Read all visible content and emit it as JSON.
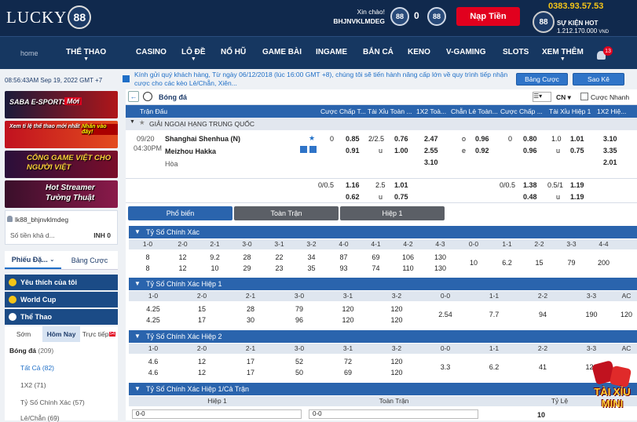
{
  "brand": {
    "name": "LUCKY",
    "badge": "88"
  },
  "header": {
    "greeting": "Xin chào!",
    "username": "BHJNVKLMDEG",
    "coin_label": "88",
    "balance": "0",
    "deposit_label": "Nạp Tiền"
  },
  "jackpot": {
    "phone": "0383.93.57.53",
    "event": "SỰ KIỆN HOT",
    "amount": "1.212.170.000",
    "currency": "VND"
  },
  "nav": {
    "home": "home",
    "items": [
      "THỂ THAO",
      "CASINO",
      "LÔ ĐỀ",
      "NỔ HŨ",
      "GAME BÀI",
      "INGAME",
      "BẮN CÁ",
      "KENO",
      "V-GAMING",
      "SLOTS",
      "XEM THÊM"
    ],
    "notify_count": "13"
  },
  "sidebar": {
    "time": "08:56:43AM Sep 19, 2022 GMT +7",
    "banners": [
      "SABA E-SPORTS",
      "Mới",
      "Xem tỉ lệ thể thao mới nhất",
      "Nhấn vào đây!",
      "CỔNG GAME VIỆT CHO NGƯỜI VIỆT",
      "Hot Streamer Tường Thuật"
    ],
    "user": "lk88_bhjnvklmdeg",
    "balance_label": "Số tiền khả d...",
    "balance_value": "INH 0",
    "tabs": [
      "Phiếu Đặ...",
      "Bảng Cược"
    ],
    "sections": [
      "Yêu thích của tôi",
      "World Cup",
      "Thể Thao"
    ],
    "subtabs": [
      "Sớm",
      "Hôm Nay",
      "Trực tiếp"
    ],
    "live_count": "54",
    "sports": [
      {
        "name": "Bóng đá",
        "count": "(209)"
      },
      {
        "name": "Tất Cả",
        "count": "(82)"
      },
      {
        "name": "1X2",
        "count": "(71)"
      },
      {
        "name": "Tỷ Số Chính Xác",
        "count": "(57)"
      },
      {
        "name": "Lẻ/Chẵn",
        "count": "(69)"
      }
    ]
  },
  "main": {
    "ticker": "Kính gửi quý khách hàng, Từ ngày 06/12/2018 (lúc 16:00 GMT +8), chúng tôi sẽ tiến hành nâng cấp lớn về quy trình tiếp nhận cược cho các kèo Lẻ/Chẵn, Xiên...",
    "btn_board": "Bảng Cược",
    "btn_statement": "Sao Kê",
    "sport": "Bóng đá",
    "lang": "CN",
    "bet_mode": "Cược Nhanh",
    "headers": [
      "Trận Đấu",
      "Cược Chấp T...",
      "Tài Xỉu Toàn ...",
      "1X2 Toà...",
      "Chẵn Lẻ Toàn...",
      "Cược Chấp ...",
      "Tài Xỉu Hiệp 1",
      "1X2 Hiệ..."
    ],
    "league": "GIẢI NGOẠI HẠNG TRUNG QUỐC",
    "match": {
      "date": "09/20",
      "time": "04:30PM",
      "home": "Shanghai Shenhua (N)",
      "away": "Meizhou Hakka",
      "draw": "Hòa",
      "r1": [
        "0",
        "0.85",
        "2/2.5",
        "0.76",
        "2.47",
        "o",
        "0.96",
        "0",
        "0.80",
        "1.0",
        "1.01",
        "3.10"
      ],
      "r2": [
        "0.91",
        "u",
        "1.00",
        "2.55",
        "e",
        "0.92",
        "0.96",
        "u",
        "0.75",
        "3.35"
      ],
      "r3": [
        "3.10",
        "2.01"
      ],
      "r4": [
        "0/0.5",
        "1.16",
        "2.5",
        "1.01",
        "0/0.5",
        "1.38",
        "0.5/1",
        "1.19"
      ],
      "r5": [
        "0.62",
        "u",
        "0.75",
        "0.48",
        "u",
        "1.19"
      ]
    },
    "market_tabs": [
      "Phổ biến",
      "Toàn Trận",
      "Hiệp 1"
    ],
    "sec1": {
      "title": "Tỷ Số Chính Xác",
      "cols": [
        "1-0",
        "2-0",
        "2-1",
        "3-0",
        "3-1",
        "3-2",
        "4-0",
        "4-1",
        "4-2",
        "4-3",
        "0-0",
        "1-1",
        "2-2",
        "3-3",
        "4-4"
      ],
      "row1": [
        "8",
        "12",
        "9.2",
        "28",
        "22",
        "34",
        "87",
        "69",
        "106",
        "130"
      ],
      "row2": [
        "8",
        "12",
        "10",
        "29",
        "23",
        "35",
        "93",
        "74",
        "110",
        "130"
      ],
      "mid": [
        "10",
        "6.2",
        "15",
        "79",
        "200"
      ]
    },
    "sec2": {
      "title": "Tỷ Số Chính Xác Hiệp 1",
      "cols": [
        "1-0",
        "2-0",
        "2-1",
        "3-0",
        "3-1",
        "3-2",
        "0-0",
        "1-1",
        "2-2",
        "3-3",
        "AC"
      ],
      "row1": [
        "4.25",
        "15",
        "28",
        "79",
        "120",
        "120"
      ],
      "row2": [
        "4.25",
        "17",
        "30",
        "96",
        "120",
        "120"
      ],
      "mid": [
        "2.54",
        "7.7",
        "94",
        "190",
        "120"
      ]
    },
    "sec3": {
      "title": "Tỷ Số Chính Xác Hiệp 2",
      "cols": [
        "1-0",
        "2-0",
        "2-1",
        "3-0",
        "3-1",
        "3-2",
        "0-0",
        "1-1",
        "2-2",
        "3-3",
        "AC"
      ],
      "row1": [
        "4.6",
        "12",
        "17",
        "52",
        "72",
        "120"
      ],
      "row2": [
        "4.6",
        "12",
        "17",
        "50",
        "69",
        "120"
      ],
      "mid": [
        "3.3",
        "6.2",
        "41",
        "120"
      ]
    },
    "sec4": {
      "title": "Tỷ Số Chính Xác Hiệp 1/Cả Trận",
      "cols": [
        "Hiệp 1",
        "Toàn Trận",
        "Tỷ Lệ"
      ],
      "row": [
        "0-0",
        "0-0",
        "10"
      ]
    }
  },
  "dice": {
    "label": "TÀI XỈU MINI"
  },
  "colors": {
    "navy": "#10294d",
    "blue": "#2a64ad",
    "red": "#e1001e"
  }
}
